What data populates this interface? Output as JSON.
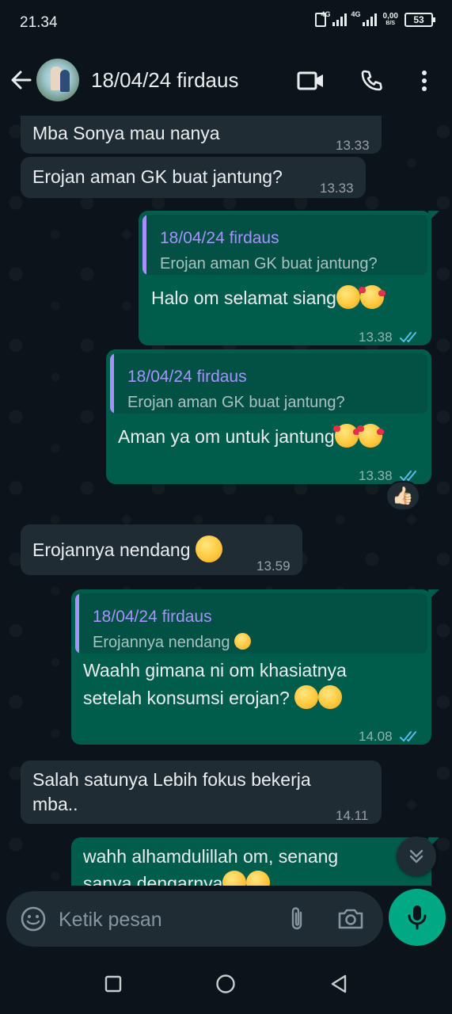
{
  "status_bar": {
    "time": "21.34",
    "net_1": "4G",
    "net_2": "4G",
    "speed_value": "0,00",
    "speed_unit": "B/S",
    "battery": "53"
  },
  "header": {
    "contact_name": "18/04/24 firdaus",
    "icons": [
      "back-arrow-icon",
      "video-call-icon",
      "voice-call-icon",
      "more-options-icon"
    ]
  },
  "messages": [
    {
      "dir": "in",
      "text": "Mba Sonya mau nanya",
      "time": "13.33"
    },
    {
      "dir": "in",
      "text": "Erojan aman GK buat jantung?",
      "time": "13.33"
    },
    {
      "dir": "out",
      "quote_name": "18/04/24 firdaus",
      "quote_text": "Erojan aman GK buat jantung?",
      "text": "Halo om selamat siang",
      "emojis": [
        "hugging-face-emoji",
        "smiling-face-with-hearts-emoji"
      ],
      "time": "13.38",
      "status": "read"
    },
    {
      "dir": "out",
      "quote_name": "18/04/24 firdaus",
      "quote_text": "Erojan aman GK buat jantung?",
      "text": "Aman ya om untuk jantung",
      "emojis": [
        "smiling-face-with-hearts-emoji",
        "smiling-face-with-hearts-emoji"
      ],
      "time": "13.38",
      "status": "read",
      "reaction": "👍🏻"
    },
    {
      "dir": "in",
      "text": "Erojannya nendang",
      "emojis": [
        "face-with-hand-over-mouth-emoji"
      ],
      "time": "13.59"
    },
    {
      "dir": "out",
      "quote_name": "18/04/24 firdaus",
      "quote_text": "Erojannya nendang",
      "quote_emoji": "face-with-hand-over-mouth-emoji",
      "text_line1": "Waahh gimana ni om khasiatnya",
      "text_line2": "setelah konsumsi erojan?",
      "emojis": [
        "grinning-face-emoji",
        "grinning-face-emoji"
      ],
      "time": "14.08",
      "status": "read"
    },
    {
      "dir": "in",
      "text_line1": "Salah satunya Lebih fokus bekerja",
      "text_line2": "mba..",
      "time": "14.11"
    },
    {
      "dir": "out",
      "text_line1": "wahh alhamdulillah om, senang",
      "text_line2": "sanya dengarnya",
      "emojis": [
        "heart-eyes-emoji",
        "heart-eyes-emoji"
      ]
    }
  ],
  "input": {
    "placeholder": "Ketik pesan"
  },
  "colors": {
    "background": "#0b141a",
    "incoming_bubble": "#202c33",
    "outgoing_bubble": "#005c4b",
    "quote_name": "#a791ff",
    "read_ticks": "#53bdeb",
    "send_button": "#00a884"
  }
}
